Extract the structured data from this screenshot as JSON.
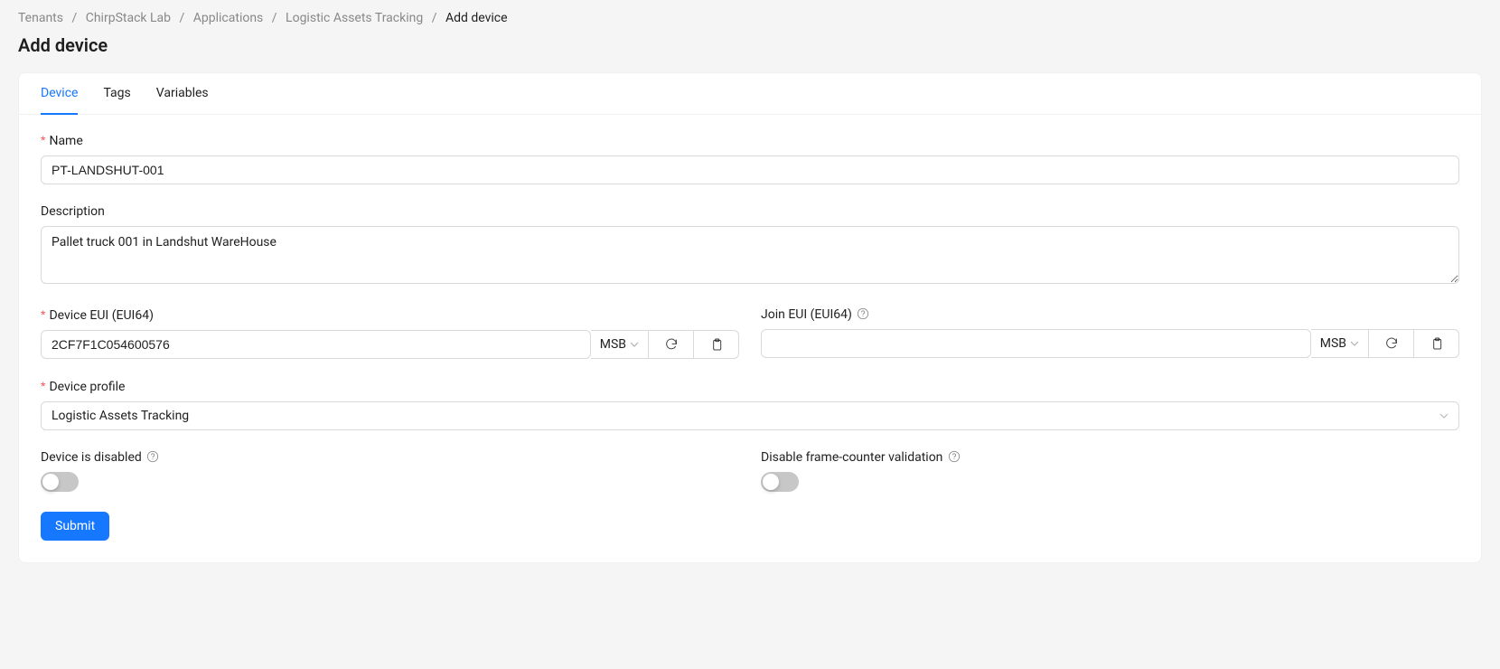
{
  "breadcrumb": {
    "items": [
      "Tenants",
      "ChirpStack Lab",
      "Applications",
      "Logistic Assets Tracking"
    ],
    "current": "Add device"
  },
  "page": {
    "title": "Add device"
  },
  "tabs": {
    "device": "Device",
    "tags": "Tags",
    "variables": "Variables"
  },
  "form": {
    "name": {
      "label": "Name",
      "value": "PT-LANDSHUT-001"
    },
    "description": {
      "label": "Description",
      "value": "Pallet truck 001 in Landshut WareHouse"
    },
    "device_eui": {
      "label": "Device EUI (EUI64)",
      "value": "2CF7F1C054600576",
      "byte_order": "MSB"
    },
    "join_eui": {
      "label": "Join EUI (EUI64)",
      "value": "",
      "byte_order": "MSB"
    },
    "device_profile": {
      "label": "Device profile",
      "value": "Logistic Assets Tracking"
    },
    "disabled": {
      "label": "Device is disabled"
    },
    "frame_counter": {
      "label": "Disable frame-counter validation"
    },
    "submit": "Submit"
  }
}
